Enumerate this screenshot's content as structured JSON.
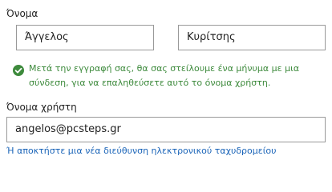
{
  "name_section": {
    "label": "Όνομα",
    "first_name_value": "Άγγελος",
    "last_name_value": "Κυρίτσης"
  },
  "notice": {
    "icon": "check-circle-icon",
    "color": "#3d8a3c",
    "text": "Μετά την εγγραφή σας, θα σας στείλουμε ένα μήνυμα με μια σύνδεση, για να επαληθεύσετε αυτό το όνομα χρήστη."
  },
  "username_section": {
    "label": "Όνομα χρήστη",
    "value": "angelos@pcsteps.gr"
  },
  "new_email_link": {
    "text": "Ή αποκτήστε μια νέα διεύθυνση ηλεκτρονικού ταχυδρομείου",
    "color": "#1a64b8"
  }
}
